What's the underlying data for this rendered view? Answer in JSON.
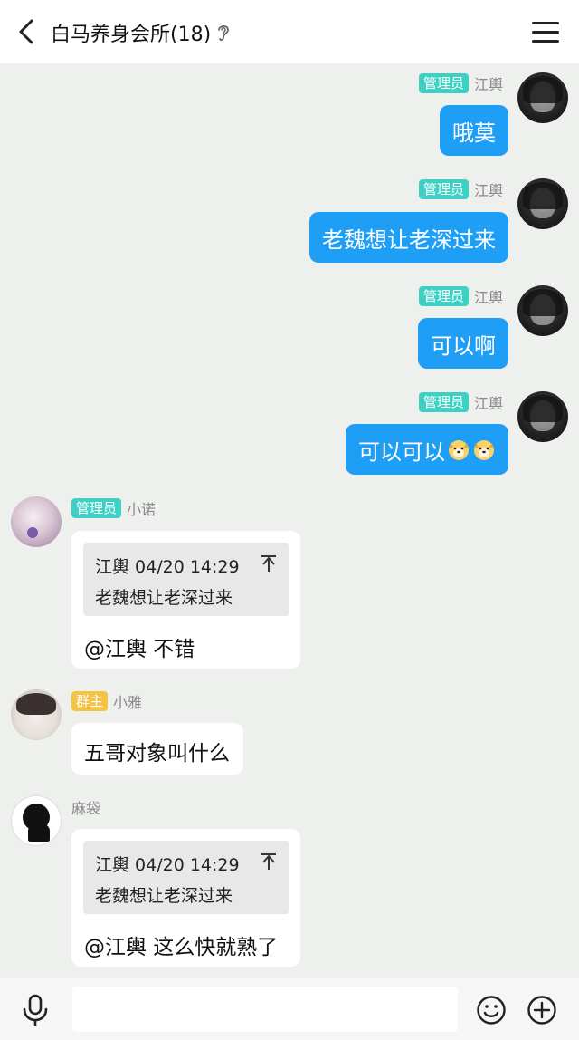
{
  "header": {
    "title": "白马养身会所(18)"
  },
  "messages": [
    {
      "side": "out",
      "badge": "管理员",
      "nick": "江輿",
      "text": "哦莫"
    },
    {
      "side": "out",
      "badge": "管理员",
      "nick": "江輿",
      "text": "老魏想让老深过来"
    },
    {
      "side": "out",
      "badge": "管理员",
      "nick": "江輿",
      "text": "可以啊"
    },
    {
      "side": "out",
      "badge": "管理员",
      "nick": "江輿",
      "text": "可以可以"
    },
    {
      "side": "in",
      "badge": "管理员",
      "nick": "小诺",
      "quote": {
        "header": "江輿 04/20 14:29",
        "body": "老魏想让老深过来"
      },
      "text": "@江輿 不错"
    },
    {
      "side": "in",
      "badge": "群主",
      "nick": "小雅",
      "text": "五哥对象叫什么"
    },
    {
      "side": "in",
      "badge": "",
      "nick": "麻袋",
      "quote": {
        "header": "江輿 04/20 14:29",
        "body": "老魏想让老深过来"
      },
      "text": "@江輿 这么快就熟了"
    }
  ],
  "colors": {
    "outgoing_bubble": "#1f9ef5",
    "admin_badge": "#3fd0c4",
    "owner_badge": "#f5c342",
    "chat_background": "#edf0ed"
  },
  "icons": {
    "back": "chevron-left-icon",
    "ear": "ear-icon",
    "menu": "hamburger-menu-icon",
    "mic": "microphone-icon",
    "emoji": "smiley-icon",
    "plus": "plus-circle-icon"
  }
}
